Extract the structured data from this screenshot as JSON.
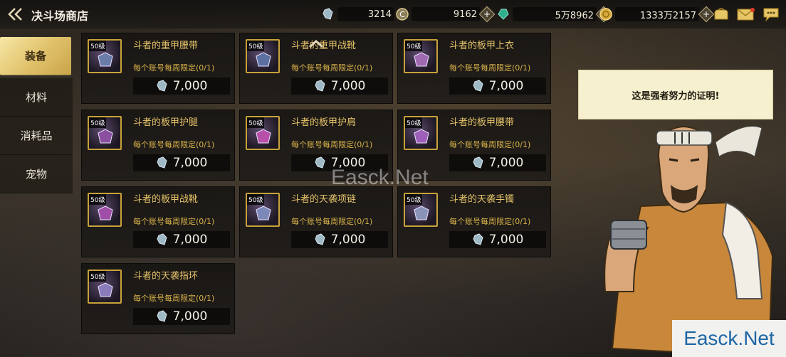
{
  "header": {
    "title": "决斗场商店",
    "currencies": [
      {
        "icon": "crystal-icon",
        "value": "3214"
      },
      {
        "icon": "coin-c-icon",
        "value": "9162"
      },
      {
        "icon": "green-gem-icon",
        "value": "5万8962"
      },
      {
        "icon": "gold-coin-icon",
        "value": "1333万2157"
      }
    ],
    "plus_symbol": "+"
  },
  "sidebar": {
    "items": [
      {
        "label": "装备",
        "active": true
      },
      {
        "label": "材料",
        "active": false
      },
      {
        "label": "消耗品",
        "active": false
      },
      {
        "label": "宠物",
        "active": false
      }
    ]
  },
  "items": [
    {
      "level": "50级",
      "name": "斗者的重甲腰带",
      "limit": "每个账号每周限定(0/1)",
      "price": "7,000"
    },
    {
      "level": "50级",
      "name": "斗者的重甲战靴",
      "limit": "每个账号每周限定(0/1)",
      "price": "7,000"
    },
    {
      "level": "50级",
      "name": "斗者的板甲上衣",
      "limit": "每个账号每周限定(0/1)",
      "price": "7,000"
    },
    {
      "level": "50级",
      "name": "斗者的板甲护腿",
      "limit": "每个账号每周限定(0/1)",
      "price": "7,000"
    },
    {
      "level": "50级",
      "name": "斗者的板甲护肩",
      "limit": "每个账号每周限定(0/1)",
      "price": "7,000"
    },
    {
      "level": "50级",
      "name": "斗者的板甲腰带",
      "limit": "每个账号每周限定(0/1)",
      "price": "7,000"
    },
    {
      "level": "50级",
      "name": "斗者的板甲战靴",
      "limit": "每个账号每周限定(0/1)",
      "price": "7,000"
    },
    {
      "level": "50级",
      "name": "斗者的天袭项链",
      "limit": "每个账号每周限定(0/1)",
      "price": "7,000"
    },
    {
      "level": "50级",
      "name": "斗者的天袭手镯",
      "limit": "每个账号每周限定(0/1)",
      "price": "7,000"
    },
    {
      "level": "50级",
      "name": "斗者的天袭指环",
      "limit": "每个账号每周限定(0/1)",
      "price": "7,000"
    }
  ],
  "npc": {
    "speech": "这是强者努力的证明!"
  },
  "watermark": {
    "center": "Easck.Net",
    "corner": "Easck.Net"
  },
  "colors": {
    "accent_gold": "#e2c46e",
    "item_name": "#e7c46a",
    "limit_text": "#d9b34a"
  }
}
